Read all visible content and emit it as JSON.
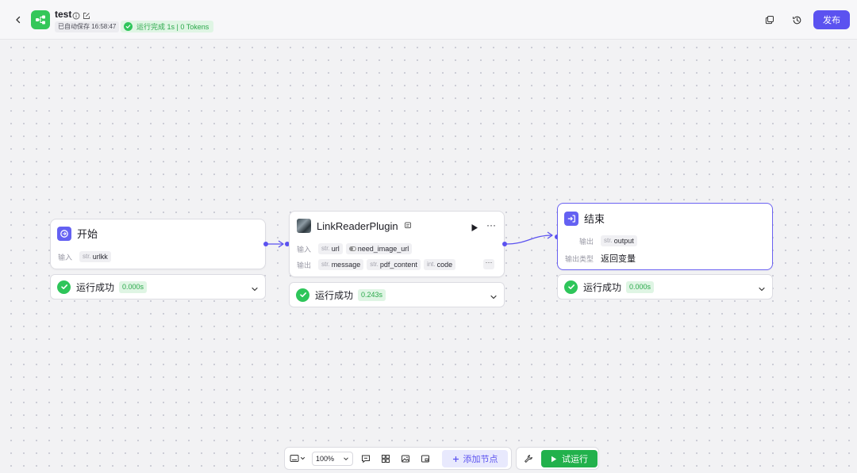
{
  "colors": {
    "accent": "#5b52f0",
    "success": "#2ec55a",
    "app_icon": "#34c759"
  },
  "header": {
    "title": "test",
    "autosave": "已自动保存 16:58:47",
    "run_status": "运行完成 1s | 0 Tokens",
    "publish_label": "发布"
  },
  "nodes": {
    "start": {
      "title": "开始",
      "input_label": "输入",
      "inputs": [
        {
          "type": "str.",
          "name": "urlkk"
        }
      ],
      "result": {
        "label": "运行成功",
        "time": "0.000s"
      }
    },
    "plugin": {
      "title": "LinkReaderPlugin",
      "input_label": "输入",
      "inputs": [
        {
          "type": "str.",
          "name": "url"
        },
        {
          "type": "",
          "name": "need_image_url"
        }
      ],
      "output_label": "输出",
      "outputs": [
        {
          "type": "str.",
          "name": "message"
        },
        {
          "type": "str.",
          "name": "pdf_content"
        },
        {
          "type": "int.",
          "name": "code"
        }
      ],
      "more": "···",
      "result": {
        "label": "运行成功",
        "time": "0.243s"
      }
    },
    "end": {
      "title": "结束",
      "output_label": "输出",
      "outputs": [
        {
          "type": "str.",
          "name": "output"
        }
      ],
      "output_type_label": "输出类型",
      "output_type_value": "返回变量",
      "result": {
        "label": "运行成功",
        "time": "0.000s"
      }
    }
  },
  "toolbar": {
    "zoom": "100%",
    "add_node_label": "添加节点",
    "trial_run_label": "试运行"
  }
}
